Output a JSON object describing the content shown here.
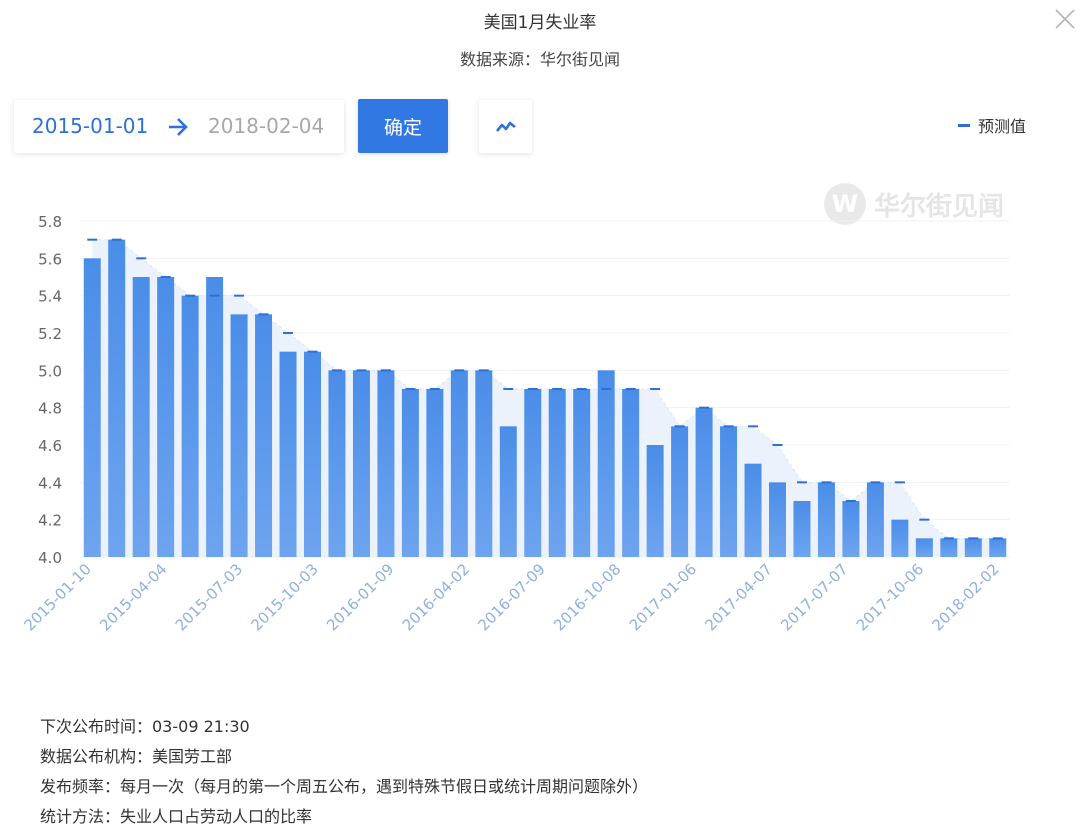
{
  "header": {
    "title": "美国1月失业率",
    "source": "数据来源：华尔街见闻",
    "close_icon": "close-icon"
  },
  "controls": {
    "start_date": "2015-01-01",
    "end_date": "2018-02-04",
    "arrow_icon": "arrow-right-icon",
    "confirm_label": "确定",
    "chart_type_icon": "line-chart-icon"
  },
  "legend": {
    "forecast_label": "预测值"
  },
  "watermark": {
    "logo_letter": "W",
    "text": "华尔街见闻"
  },
  "colors": {
    "bar": "#4a8de8",
    "bar_light": "#6ea4ef",
    "forecast": "#2f6fd6",
    "accent": "#3178e3",
    "tick": "#8fb0e0"
  },
  "chart_data": {
    "type": "bar",
    "ylim": [
      4.0,
      5.8
    ],
    "yticks": [
      "5.8",
      "5.6",
      "5.4",
      "5.2",
      "5.0",
      "4.8",
      "4.6",
      "4.4",
      "4.2",
      "4.0"
    ],
    "xtick_labels": [
      "2015-01-10",
      "2015-04-04",
      "2015-07-03",
      "2015-10-03",
      "2016-01-09",
      "2016-04-02",
      "2016-07-09",
      "2016-10-08",
      "2017-01-06",
      "2017-04-07",
      "2017-07-07",
      "2017-10-06",
      "2018-02-02"
    ],
    "series": [
      {
        "values": [
          5.6,
          5.7,
          5.5,
          5.5,
          5.4,
          5.5,
          5.3,
          5.3,
          5.1,
          5.1,
          5.0,
          5.0,
          5.0,
          4.9,
          4.9,
          5.0,
          5.0,
          4.7,
          4.9,
          4.9,
          4.9,
          5.0,
          4.9,
          4.6,
          4.7,
          4.8,
          4.7,
          4.5,
          4.4,
          4.3,
          4.4,
          4.3,
          4.4,
          4.2,
          4.1,
          4.1,
          4.1,
          4.1
        ]
      },
      {
        "values": [
          5.7,
          5.7,
          5.6,
          5.5,
          5.4,
          5.4,
          5.4,
          5.3,
          5.2,
          5.1,
          5.0,
          5.0,
          5.0,
          4.9,
          4.9,
          5.0,
          5.0,
          4.9,
          4.9,
          4.9,
          4.9,
          4.9,
          4.9,
          4.9,
          4.7,
          4.8,
          4.7,
          4.7,
          4.6,
          4.4,
          4.4,
          4.3,
          4.4,
          4.4,
          4.2,
          4.1,
          4.1,
          4.1
        ]
      }
    ]
  },
  "info": {
    "next_release": "下次公布时间：03-09 21:30",
    "agency": "数据公布机构：美国劳工部",
    "frequency": "发布频率：每月一次（每月的第一个周五公布，遇到特殊节假日或统计周期问题除外）",
    "method": "统计方法：失业人口占劳动人口的比率"
  }
}
